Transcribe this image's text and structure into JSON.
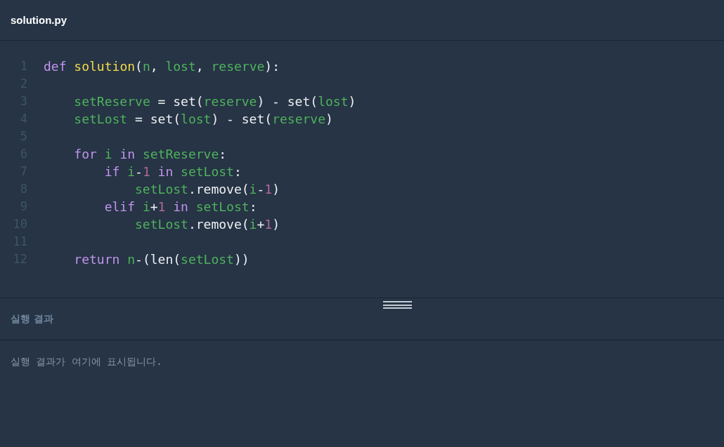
{
  "editor": {
    "filename": "solution.py",
    "lines": [
      {
        "number": "1",
        "tokens": [
          {
            "text": "def ",
            "kind": "keyword"
          },
          {
            "text": "solution",
            "kind": "function"
          },
          {
            "text": "(",
            "kind": "plain"
          },
          {
            "text": "n",
            "kind": "name"
          },
          {
            "text": ", ",
            "kind": "plain"
          },
          {
            "text": "lost",
            "kind": "name"
          },
          {
            "text": ", ",
            "kind": "plain"
          },
          {
            "text": "reserve",
            "kind": "name"
          },
          {
            "text": "):",
            "kind": "plain"
          }
        ],
        "children": [
          {
            "number": "2"
          },
          {
            "number": "3",
            "tokens": [
              {
                "text": "setReserve",
                "kind": "name"
              },
              {
                "text": " = set(",
                "kind": "plain"
              },
              {
                "text": "reserve",
                "kind": "name"
              },
              {
                "text": ") - set(",
                "kind": "plain"
              },
              {
                "text": "lost",
                "kind": "name"
              },
              {
                "text": ")",
                "kind": "plain"
              }
            ]
          },
          {
            "number": "4",
            "tokens": [
              {
                "text": "setLost",
                "kind": "name"
              },
              {
                "text": " = set(",
                "kind": "plain"
              },
              {
                "text": "lost",
                "kind": "name"
              },
              {
                "text": ") - set(",
                "kind": "plain"
              },
              {
                "text": "reserve",
                "kind": "name"
              },
              {
                "text": ")",
                "kind": "plain"
              }
            ]
          },
          {
            "number": "5"
          },
          {
            "number": "6",
            "tokens": [
              {
                "text": "for ",
                "kind": "keyword"
              },
              {
                "text": "i",
                "kind": "name"
              },
              {
                "text": " in ",
                "kind": "keyword"
              },
              {
                "text": "setReserve",
                "kind": "name"
              },
              {
                "text": ":",
                "kind": "plain"
              }
            ],
            "children": [
              {
                "number": "7",
                "tokens": [
                  {
                    "text": "if ",
                    "kind": "keyword"
                  },
                  {
                    "text": "i",
                    "kind": "name"
                  },
                  {
                    "text": "-",
                    "kind": "plain"
                  },
                  {
                    "text": "1",
                    "kind": "number"
                  },
                  {
                    "text": " in ",
                    "kind": "keyword"
                  },
                  {
                    "text": "setLost",
                    "kind": "name"
                  },
                  {
                    "text": ":",
                    "kind": "plain"
                  }
                ],
                "children": [
                  {
                    "number": "8",
                    "tokens": [
                      {
                        "text": "setLost",
                        "kind": "name"
                      },
                      {
                        "text": ".remove(",
                        "kind": "plain"
                      },
                      {
                        "text": "i",
                        "kind": "name"
                      },
                      {
                        "text": "-",
                        "kind": "plain"
                      },
                      {
                        "text": "1",
                        "kind": "number"
                      },
                      {
                        "text": ")",
                        "kind": "plain"
                      }
                    ]
                  }
                ]
              },
              {
                "number": "9",
                "tokens": [
                  {
                    "text": "elif ",
                    "kind": "keyword"
                  },
                  {
                    "text": "i",
                    "kind": "name"
                  },
                  {
                    "text": "+",
                    "kind": "plain"
                  },
                  {
                    "text": "1",
                    "kind": "number"
                  },
                  {
                    "text": " in ",
                    "kind": "keyword"
                  },
                  {
                    "text": "setLost",
                    "kind": "name"
                  },
                  {
                    "text": ":",
                    "kind": "plain"
                  }
                ],
                "children": [
                  {
                    "number": "10",
                    "tokens": [
                      {
                        "text": "setLost",
                        "kind": "name"
                      },
                      {
                        "text": ".remove(",
                        "kind": "plain"
                      },
                      {
                        "text": "i",
                        "kind": "name"
                      },
                      {
                        "text": "+",
                        "kind": "plain"
                      },
                      {
                        "text": "1",
                        "kind": "number"
                      },
                      {
                        "text": ")",
                        "kind": "plain"
                      }
                    ]
                  }
                ]
              }
            ]
          },
          {
            "number": "11"
          },
          {
            "number": "12",
            "tokens": [
              {
                "text": "return ",
                "kind": "keyword"
              },
              {
                "text": "n",
                "kind": "name"
              },
              {
                "text": "-(len(",
                "kind": "plain"
              },
              {
                "text": "setLost",
                "kind": "name"
              },
              {
                "text": "))",
                "kind": "plain"
              }
            ]
          }
        ]
      }
    ]
  },
  "results": {
    "title": "실행 결과",
    "message": "실행 결과가 여기에 표시됩니다."
  }
}
